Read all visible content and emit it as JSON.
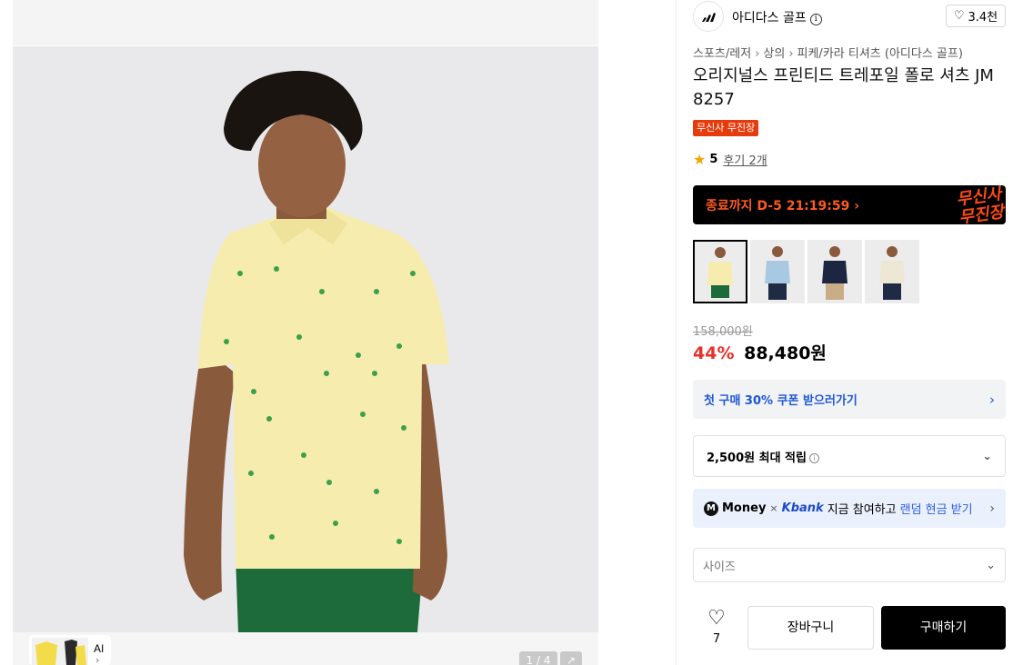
{
  "gallery": {
    "ai_label": "AI",
    "ai_chevron": "›",
    "counter": "1 / 4",
    "expand_icon": "↗"
  },
  "brand": {
    "name": "아디다스 골프",
    "info_icon": "i",
    "like_label": "3.4천",
    "heart_icon": "♡"
  },
  "breadcrumb": {
    "items": [
      "스포츠/레저",
      "상의",
      "피케/카라 티셔츠 (아디다스 골프)"
    ],
    "sep": "›"
  },
  "product": {
    "title": "오리지널스 프린티드 트레포일 폴로 셔츠 JM 8257",
    "badge": "무신사 무진장",
    "rating_star": "★",
    "rating_score": "5",
    "review_label": "후기 2개"
  },
  "sale_banner": {
    "countdown": "종료까지 D-5 21:19:59 ›",
    "logo_line1": "무신사",
    "logo_line2": "무진장"
  },
  "price": {
    "original": "158,000원",
    "discount": "44%",
    "final": "88,480원"
  },
  "coupon": {
    "label": "첫 구매 30% 쿠폰 받으러가기",
    "chevron": "›"
  },
  "points": {
    "label": "2,500원 최대 적립",
    "info_icon": "i",
    "chevron": "⌄"
  },
  "kbank": {
    "m_logo": "M",
    "money": "Money",
    "x": "×",
    "kbank": "Kbank",
    "text": "지금 참여하고",
    "highlight": "랜덤 현금 받기",
    "chevron": "›"
  },
  "size": {
    "placeholder": "사이즈",
    "chevron": "⌄"
  },
  "actions": {
    "wish_icon": "♡",
    "wish_count": "7",
    "cart": "장바구니",
    "buy": "구매하기"
  },
  "colors": {
    "accent_red": "#e8302a",
    "badge_red": "#e53b0d",
    "coupon_blue": "#1e57d6",
    "banner_orange": "#ff4a14"
  }
}
